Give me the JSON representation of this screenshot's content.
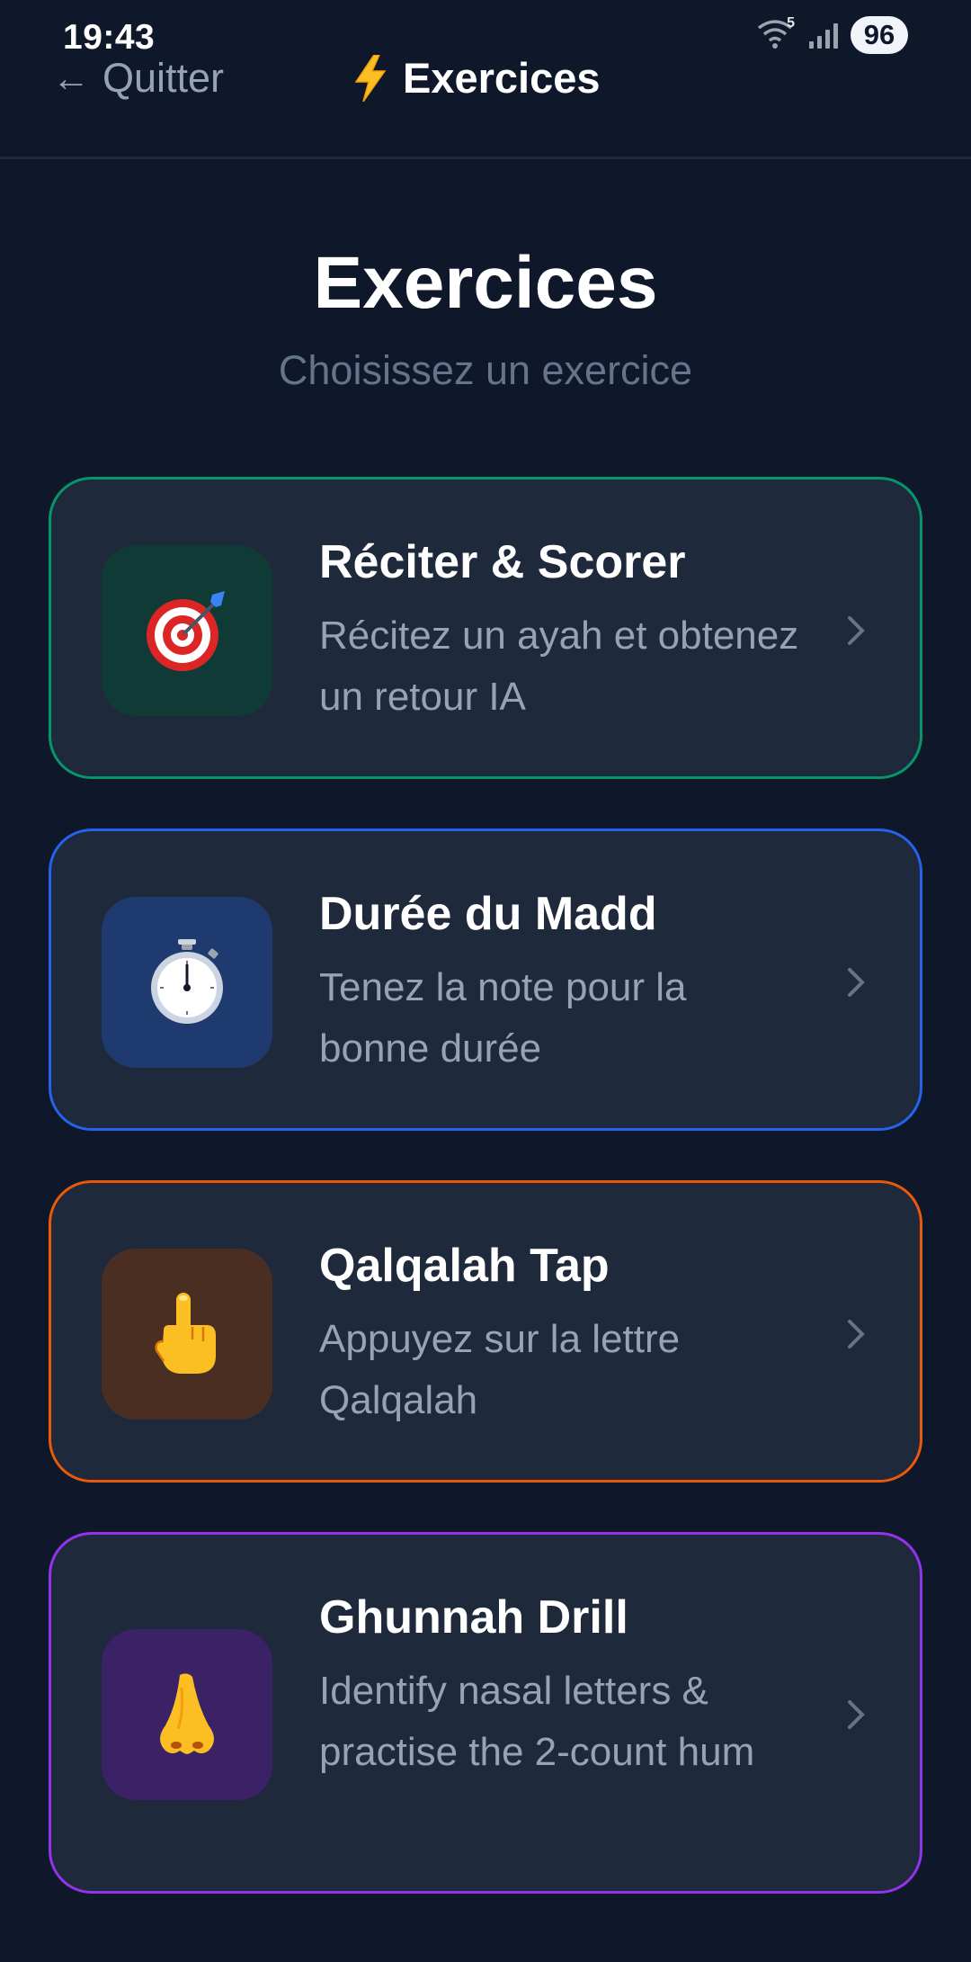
{
  "status": {
    "time": "19:43",
    "wifi_badge": "5",
    "battery": "96"
  },
  "nav": {
    "back_label": "Quitter",
    "back_arrow": "←",
    "title": "Exercices"
  },
  "header": {
    "title": "Exercices",
    "subtitle": "Choisissez un exercice"
  },
  "exercises": [
    {
      "title": "Réciter & Scorer",
      "description": "Récitez un ayah et obtenez un retour IA",
      "icon": "target-icon",
      "accent": "#059669",
      "icon_bg": "#0f3a36"
    },
    {
      "title": "Durée du Madd",
      "description": "Tenez la note pour la bonne durée",
      "icon": "stopwatch-icon",
      "accent": "#2563eb",
      "icon_bg": "#1e3a6e"
    },
    {
      "title": "Qalqalah Tap",
      "description": "Appuyez sur la lettre Qalqalah",
      "icon": "pointing-hand-icon",
      "accent": "#ea580c",
      "icon_bg": "#4a2e22"
    },
    {
      "title": "Ghunnah Drill",
      "description": "Identify nasal letters & practise the 2-count hum",
      "icon": "nose-icon",
      "accent": "#9333ea",
      "icon_bg": "#3b2166"
    }
  ]
}
